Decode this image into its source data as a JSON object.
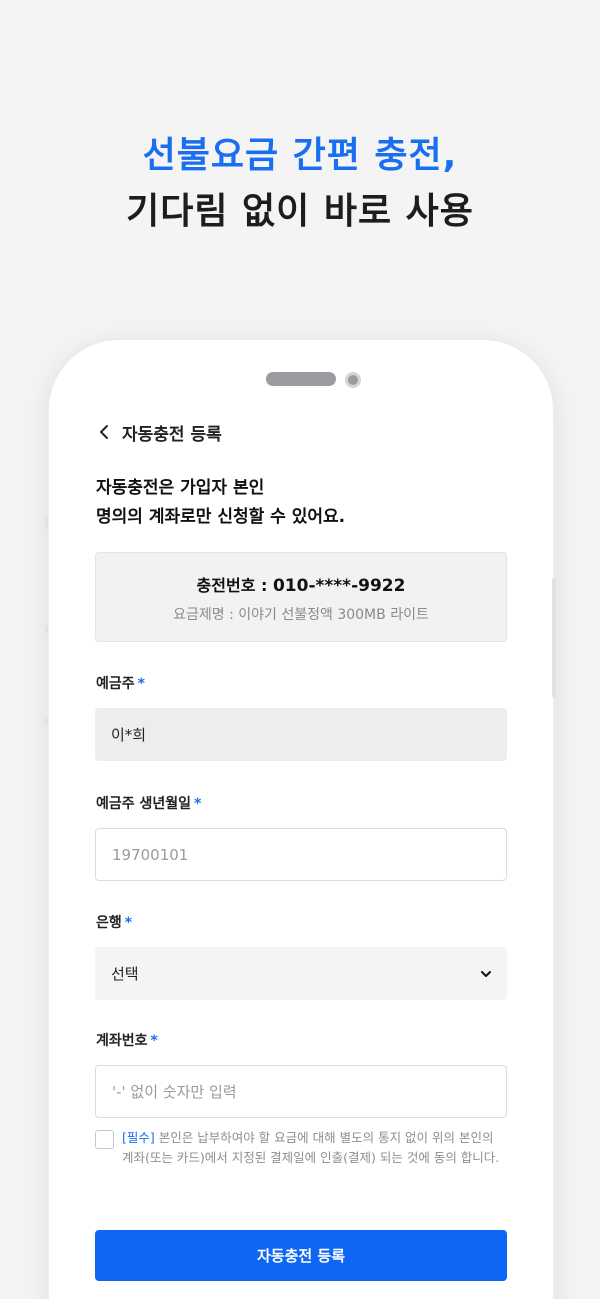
{
  "headline": {
    "line1": "선불요금 간편 충전,",
    "line2": "기다림 없이 바로 사용"
  },
  "nav": {
    "back_icon": "chevron-left-icon",
    "title": "자동충전 등록"
  },
  "notice": {
    "line1": "자동충전은 가입자 본인",
    "line2": "명의의 계좌로만 신청할 수 있어요."
  },
  "info": {
    "number_label": "충전번호 : ",
    "number_value": "010-****-9922",
    "plan_text": "요금제명 : 이야기 선불정액 300MB 라이트"
  },
  "form": {
    "required_mark": "*",
    "holder": {
      "label": "예금주",
      "value": "이*희"
    },
    "birth": {
      "label": "예금주 생년월일",
      "placeholder": "19700101"
    },
    "bank": {
      "label": "은행",
      "selected": "선택",
      "icon": "chevron-down-icon"
    },
    "account": {
      "label": "계좌번호",
      "placeholder": "'-' 없이 숫자만 입력"
    }
  },
  "agreement": {
    "tag": "[필수]",
    "text": " 본인은 납부하여야 할 요금에 대해 별도의 통지 없이 위의 본인의 계좌(또는 카드)에서 지정된 결제일에 인출(결제) 되는 것에 동의 합니다."
  },
  "submit_label": "자동충전 등록",
  "colors": {
    "accent": "#1a6ef0",
    "button": "#0f66f5",
    "background": "#f4f4f5"
  }
}
